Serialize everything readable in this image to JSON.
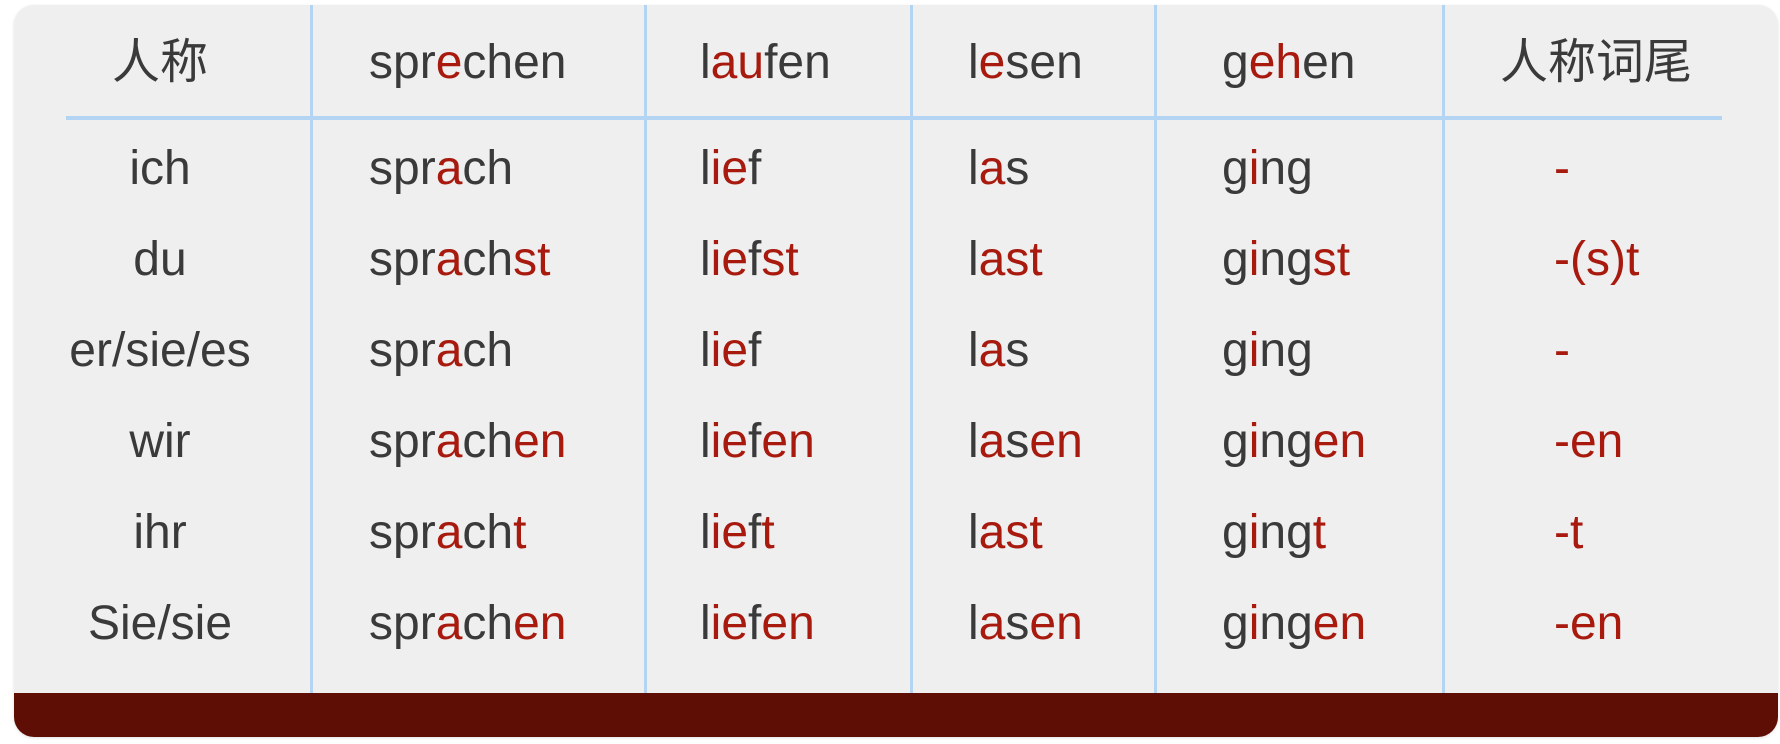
{
  "colors": {
    "text": "#3a3a3a",
    "highlight": "#a8190e",
    "grid": "#b3d4f2",
    "background": "#efefef",
    "footer": "#5e0e04"
  },
  "header": {
    "person": "人称",
    "verbs": [
      [
        {
          "t": "spr",
          "h": false
        },
        {
          "t": "e",
          "h": true
        },
        {
          "t": "chen",
          "h": false
        }
      ],
      [
        {
          "t": "l",
          "h": false
        },
        {
          "t": "au",
          "h": true
        },
        {
          "t": "fen",
          "h": false
        }
      ],
      [
        {
          "t": "l",
          "h": false
        },
        {
          "t": "e",
          "h": true
        },
        {
          "t": "sen",
          "h": false
        }
      ],
      [
        {
          "t": "g",
          "h": false
        },
        {
          "t": "eh",
          "h": true
        },
        {
          "t": "en",
          "h": false
        }
      ]
    ],
    "ending": "人称词尾"
  },
  "rows": [
    {
      "person": "ich",
      "forms": [
        [
          {
            "t": "spr",
            "h": false
          },
          {
            "t": "a",
            "h": true
          },
          {
            "t": "ch",
            "h": false
          }
        ],
        [
          {
            "t": "l",
            "h": false
          },
          {
            "t": "ie",
            "h": true
          },
          {
            "t": "f",
            "h": false
          }
        ],
        [
          {
            "t": "l",
            "h": false
          },
          {
            "t": "a",
            "h": true
          },
          {
            "t": "s",
            "h": false
          }
        ],
        [
          {
            "t": "g",
            "h": false
          },
          {
            "t": "i",
            "h": true
          },
          {
            "t": "ng",
            "h": false
          }
        ]
      ],
      "ending": "-"
    },
    {
      "person": "du",
      "forms": [
        [
          {
            "t": "spr",
            "h": false
          },
          {
            "t": "a",
            "h": true
          },
          {
            "t": "ch",
            "h": false
          },
          {
            "t": "st",
            "h": true
          }
        ],
        [
          {
            "t": "l",
            "h": false
          },
          {
            "t": "ie",
            "h": true
          },
          {
            "t": "f",
            "h": false
          },
          {
            "t": "st",
            "h": true
          }
        ],
        [
          {
            "t": "l",
            "h": false
          },
          {
            "t": "a",
            "h": true
          },
          {
            "t": "st",
            "h": true
          }
        ],
        [
          {
            "t": "g",
            "h": false
          },
          {
            "t": "i",
            "h": true
          },
          {
            "t": "ng",
            "h": false
          },
          {
            "t": "st",
            "h": true
          }
        ]
      ],
      "ending": "-(s)t"
    },
    {
      "person": "er/sie/es",
      "forms": [
        [
          {
            "t": "spr",
            "h": false
          },
          {
            "t": "a",
            "h": true
          },
          {
            "t": "ch",
            "h": false
          }
        ],
        [
          {
            "t": "l",
            "h": false
          },
          {
            "t": "ie",
            "h": true
          },
          {
            "t": "f",
            "h": false
          }
        ],
        [
          {
            "t": "l",
            "h": false
          },
          {
            "t": "a",
            "h": true
          },
          {
            "t": "s",
            "h": false
          }
        ],
        [
          {
            "t": "g",
            "h": false
          },
          {
            "t": "i",
            "h": true
          },
          {
            "t": "ng",
            "h": false
          }
        ]
      ],
      "ending": "-"
    },
    {
      "person": "wir",
      "forms": [
        [
          {
            "t": "spr",
            "h": false
          },
          {
            "t": "a",
            "h": true
          },
          {
            "t": "ch",
            "h": false
          },
          {
            "t": "en",
            "h": true
          }
        ],
        [
          {
            "t": "l",
            "h": false
          },
          {
            "t": "ie",
            "h": true
          },
          {
            "t": "f",
            "h": false
          },
          {
            "t": "en",
            "h": true
          }
        ],
        [
          {
            "t": "l",
            "h": false
          },
          {
            "t": "a",
            "h": true
          },
          {
            "t": "s",
            "h": false
          },
          {
            "t": "en",
            "h": true
          }
        ],
        [
          {
            "t": "g",
            "h": false
          },
          {
            "t": "i",
            "h": true
          },
          {
            "t": "ng",
            "h": false
          },
          {
            "t": "en",
            "h": true
          }
        ]
      ],
      "ending": "-en"
    },
    {
      "person": "ihr",
      "forms": [
        [
          {
            "t": "spr",
            "h": false
          },
          {
            "t": "a",
            "h": true
          },
          {
            "t": "ch",
            "h": false
          },
          {
            "t": "t",
            "h": true
          }
        ],
        [
          {
            "t": "l",
            "h": false
          },
          {
            "t": "ie",
            "h": true
          },
          {
            "t": "f",
            "h": false
          },
          {
            "t": "t",
            "h": true
          }
        ],
        [
          {
            "t": "l",
            "h": false
          },
          {
            "t": "a",
            "h": true
          },
          {
            "t": "st",
            "h": true
          }
        ],
        [
          {
            "t": "g",
            "h": false
          },
          {
            "t": "i",
            "h": true
          },
          {
            "t": "ng",
            "h": false
          },
          {
            "t": "t",
            "h": true
          }
        ]
      ],
      "ending": "-t"
    },
    {
      "person": "Sie/sie",
      "forms": [
        [
          {
            "t": "spr",
            "h": false
          },
          {
            "t": "a",
            "h": true
          },
          {
            "t": "ch",
            "h": false
          },
          {
            "t": "en",
            "h": true
          }
        ],
        [
          {
            "t": "l",
            "h": false
          },
          {
            "t": "ie",
            "h": true
          },
          {
            "t": "f",
            "h": false
          },
          {
            "t": "en",
            "h": true
          }
        ],
        [
          {
            "t": "l",
            "h": false
          },
          {
            "t": "a",
            "h": true
          },
          {
            "t": "s",
            "h": false
          },
          {
            "t": "en",
            "h": true
          }
        ],
        [
          {
            "t": "g",
            "h": false
          },
          {
            "t": "i",
            "h": true
          },
          {
            "t": "ng",
            "h": false
          },
          {
            "t": "en",
            "h": true
          }
        ]
      ],
      "ending": "-en"
    }
  ]
}
